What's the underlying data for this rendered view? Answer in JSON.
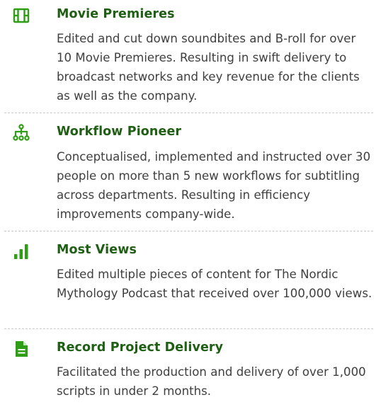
{
  "achievements": [
    {
      "icon": "film-icon",
      "title": "Movie Premieres",
      "description": "Edited and cut down soundbites and B-roll for over 10 Movie Premieres. Resulting in swift delivery to broadcast networks and key revenue for the clients as well as the company."
    },
    {
      "icon": "sitemap-icon",
      "title": "Workflow Pioneer",
      "description": "Conceptualised, implemented and instructed over 30 people on more than 5 new workflows for subtitling across departments. Resulting in efficiency improvements company-wide."
    },
    {
      "icon": "bar-chart-icon",
      "title": "Most Views",
      "description": "Edited multiple pieces of content for The Nordic Mythology Podcast that received over 100,000 views."
    },
    {
      "icon": "document-icon",
      "title": "Record Project Delivery",
      "description": "Facilitated the production and delivery of over 1,000 scripts in under 2 months."
    }
  ],
  "colors": {
    "accent": "#2e9e14",
    "title": "#1f5f14",
    "text": "#3f3f3f",
    "divider": "#c8c8c8"
  }
}
